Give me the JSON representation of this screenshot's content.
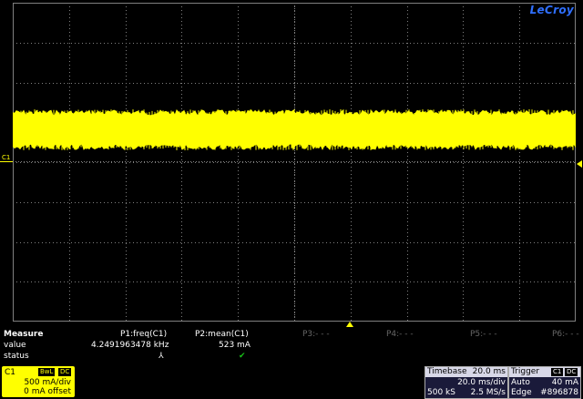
{
  "brand": "LeCroy",
  "channel_marker": "C1",
  "measure": {
    "header": "Measure",
    "row_value_label": "value",
    "row_status_label": "status",
    "p1_name": "P1:freq(C1)",
    "p1_value": "4.2491963478 kHz",
    "p1_status": "⅄",
    "p2_name": "P2:mean(C1)",
    "p2_value": "523 mA",
    "p2_status": "✔",
    "p3_name": "P3:- - -",
    "p4_name": "P4:- - -",
    "p5_name": "P5:- - -",
    "p6_name": "P6:- - -"
  },
  "channel": {
    "label": "C1",
    "bwl": "BwL",
    "coupling": "DC",
    "scale": "500 mA/div",
    "offset": "0 mA offset"
  },
  "timebase": {
    "title": "Timebase",
    "title_value": "20.0 ms",
    "per_div": "20.0 ms/div",
    "samples": "500 kS",
    "rate": "2.5 MS/s"
  },
  "trigger": {
    "title": "Trigger",
    "source": "C1",
    "coupling": "DC",
    "mode": "Auto",
    "level": "40 mA",
    "type": "Edge",
    "id": "#896878"
  },
  "colors": {
    "trace": "#ffff00",
    "background": "#000000",
    "grid": "#808080",
    "brand": "#2f6fff"
  }
}
